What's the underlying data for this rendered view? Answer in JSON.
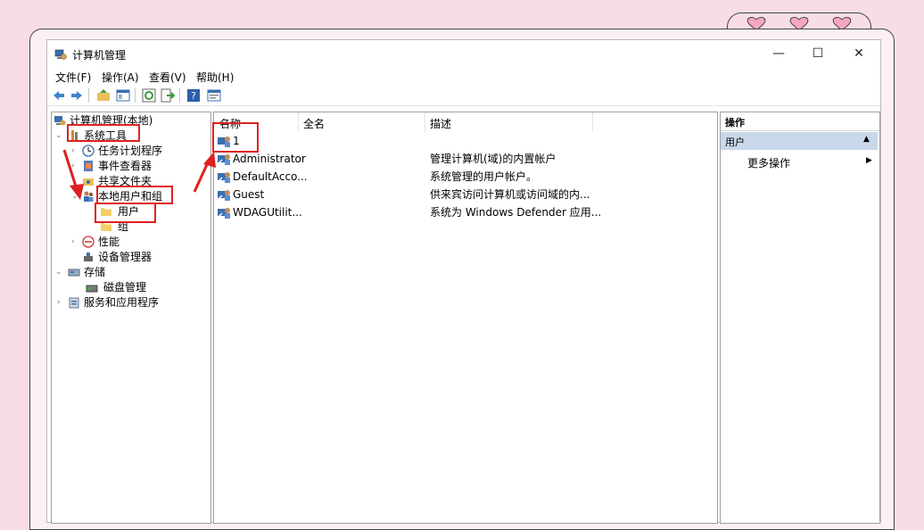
{
  "window": {
    "title": "计算机管理",
    "minimize_glyph": "—",
    "maximize_glyph": "☐",
    "close_glyph": "✕"
  },
  "menu": [
    "文件(F)",
    "操作(A)",
    "查看(V)",
    "帮助(H)"
  ],
  "toolbar_icons": [
    "back-arrow-icon",
    "forward-arrow-icon",
    "up-folder-icon",
    "show-hide-tree-icon",
    "refresh-icon",
    "export-list-icon",
    "help-icon",
    "properties-icon"
  ],
  "tree": {
    "root": "计算机管理(本地)",
    "system_tools": "系统工具",
    "task_scheduler": "任务计划程序",
    "event_viewer": "事件查看器",
    "shared_folders": "共享文件夹",
    "local_users_groups": "本地用户和组",
    "users": "用户",
    "groups": "组",
    "performance": "性能",
    "device_manager": "设备管理器",
    "storage": "存储",
    "disk_management": "磁盘管理",
    "services_apps": "服务和应用程序"
  },
  "list": {
    "columns": {
      "name": "名称",
      "fullname": "全名",
      "description": "描述"
    },
    "rows": [
      {
        "name": "1",
        "fullname": "",
        "description": ""
      },
      {
        "name": "Administrator",
        "fullname": "",
        "description": "管理计算机(域)的内置帐户"
      },
      {
        "name": "DefaultAcco...",
        "fullname": "",
        "description": "系统管理的用户帐户。"
      },
      {
        "name": "Guest",
        "fullname": "",
        "description": "供来宾访问计算机或访问域的内..."
      },
      {
        "name": "WDAGUtilit...",
        "fullname": "",
        "description": "系统为 Windows Defender 应用..."
      }
    ]
  },
  "actions": {
    "header": "操作",
    "section": "用户",
    "more": "更多操作"
  },
  "colors": {
    "background": "#f9dde6",
    "annotation_red": "#e02020",
    "action_section": "#c9d8ea"
  }
}
